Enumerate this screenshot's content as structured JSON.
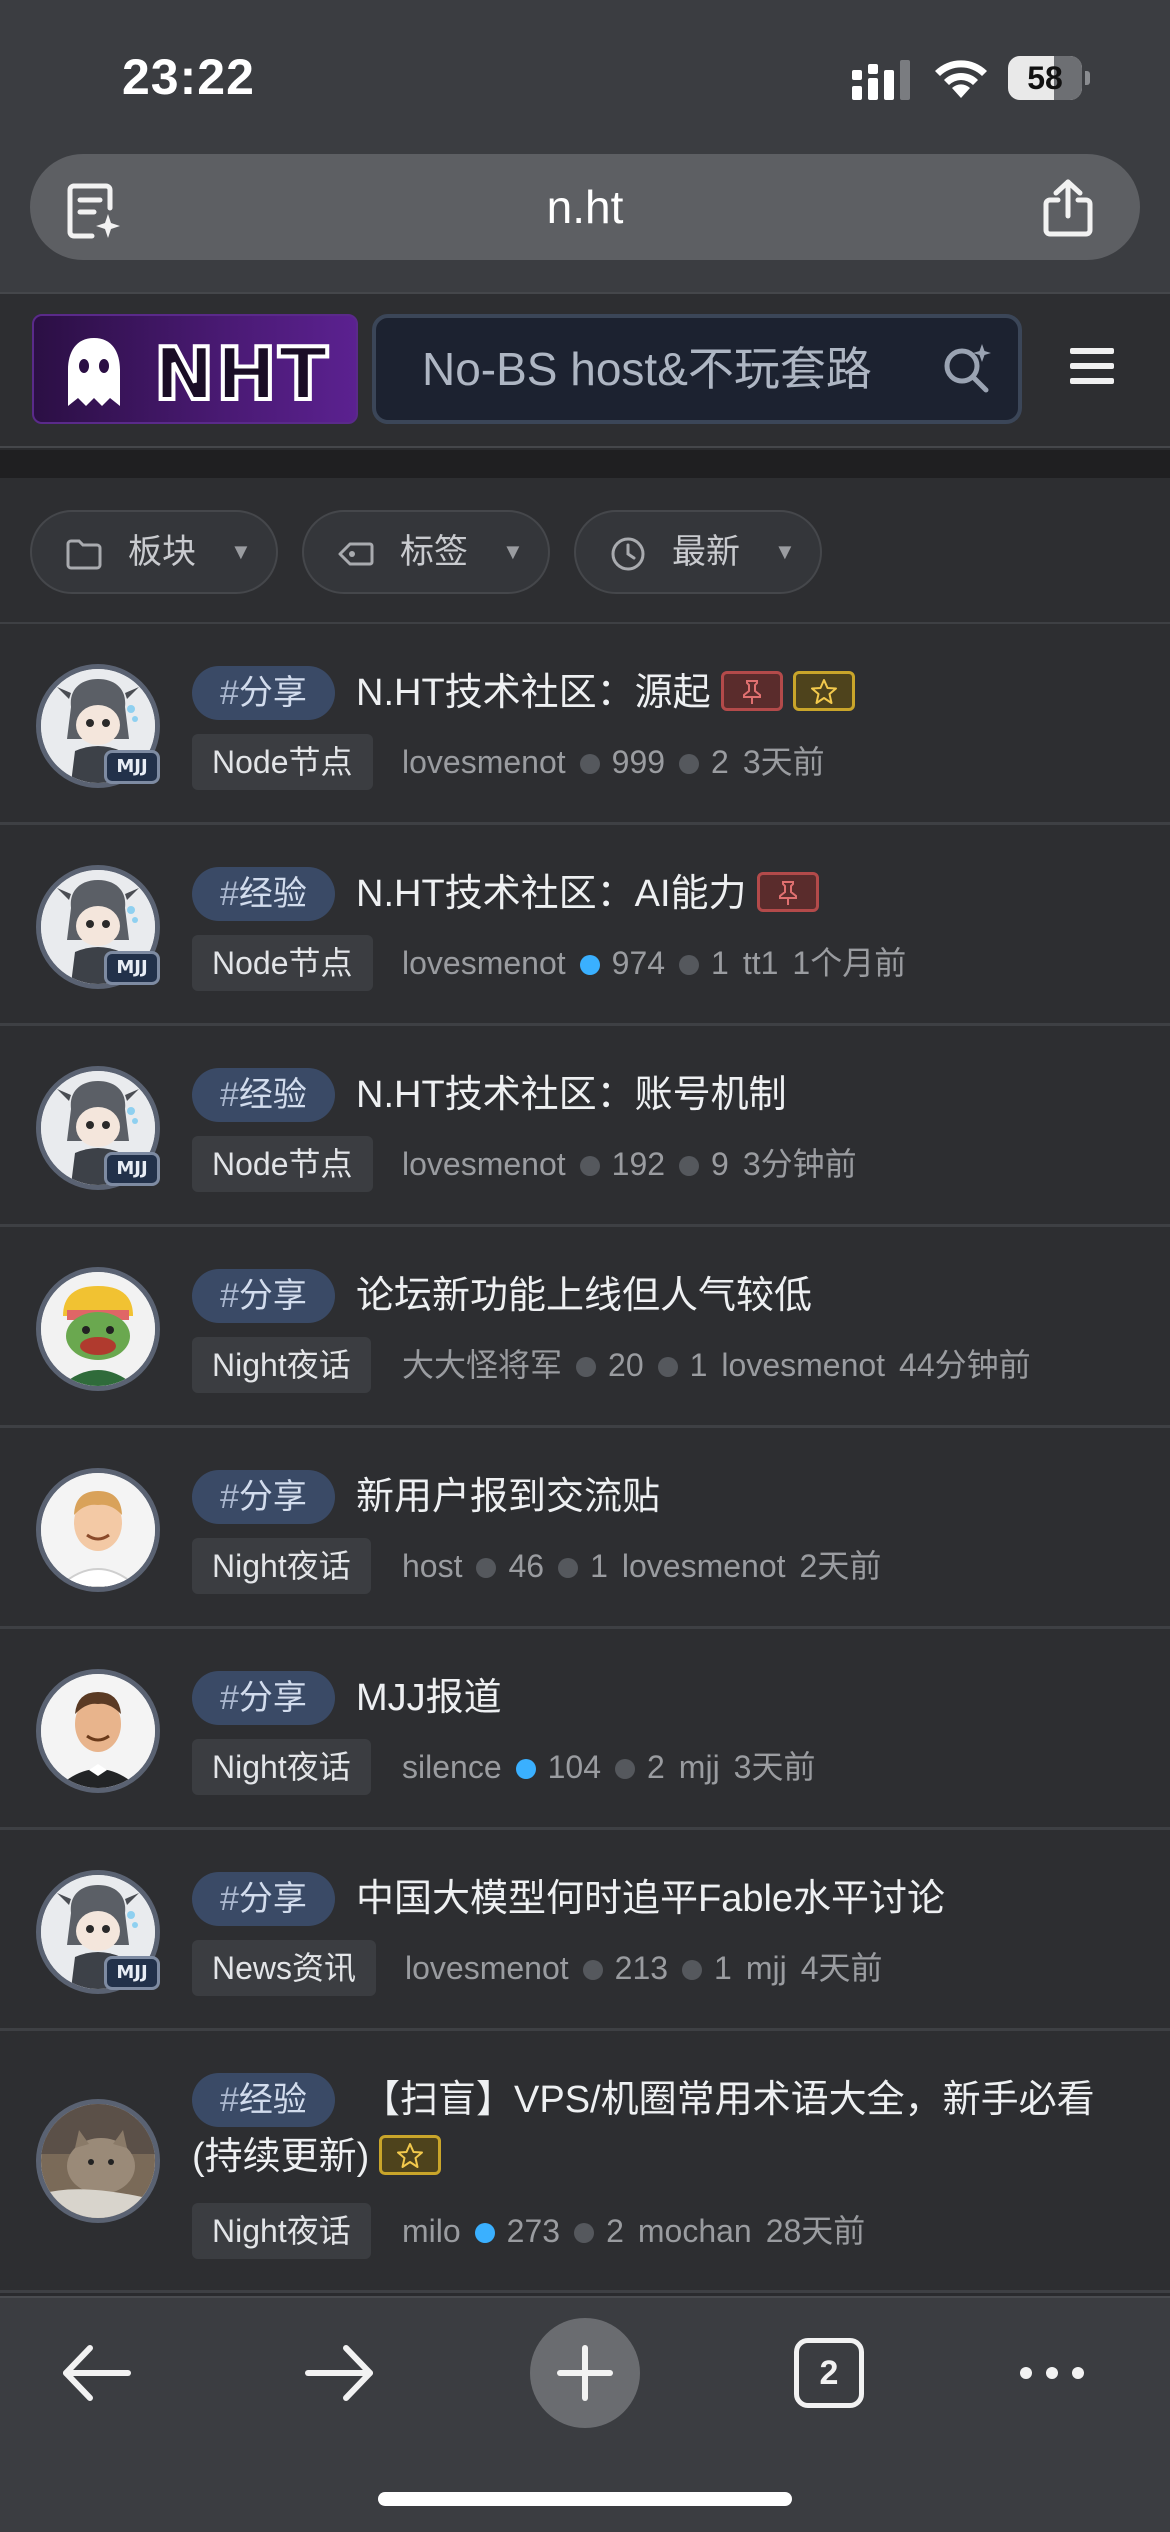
{
  "status_bar": {
    "time": "23:22",
    "battery": "58"
  },
  "browser": {
    "url": "n.ht",
    "tab_count": "2"
  },
  "site": {
    "logo_text": "NHT",
    "search_text": "No-BS host&不玩套路"
  },
  "filters": [
    {
      "label": "板块",
      "icon": "folder-icon"
    },
    {
      "label": "标签",
      "icon": "tag-icon"
    },
    {
      "label": "最新",
      "icon": "clock-icon"
    }
  ],
  "posts": [
    {
      "tag_hash": "#",
      "tag": "分享",
      "title": "N.HT技术社区：源起",
      "badges": [
        "pin",
        "star"
      ],
      "category": "Node节点",
      "author": "lovesmenot",
      "views": "999",
      "replies": "2",
      "last_user": "",
      "time": "3天前",
      "views_dot": "grey",
      "avatar": "mascot"
    },
    {
      "tag_hash": "#",
      "tag": "经验",
      "title": "N.HT技术社区：AI能力",
      "badges": [
        "pin"
      ],
      "category": "Node节点",
      "author": "lovesmenot",
      "views": "974",
      "replies": "1",
      "last_user": "tt1",
      "time": "1个月前",
      "views_dot": "blue",
      "avatar": "mascot"
    },
    {
      "tag_hash": "#",
      "tag": "经验",
      "title": "N.HT技术社区：账号机制",
      "badges": [],
      "category": "Node节点",
      "author": "lovesmenot",
      "views": "192",
      "replies": "9",
      "last_user": "",
      "time": "3分钟前",
      "views_dot": "grey",
      "avatar": "mascot"
    },
    {
      "tag_hash": "#",
      "tag": "分享",
      "title": "论坛新功能上线但人气较低",
      "badges": [],
      "category": "Night夜话",
      "author": "大大怪将军",
      "views": "20",
      "replies": "1",
      "last_user": "lovesmenot",
      "time": "44分钟前",
      "views_dot": "grey",
      "avatar": "general"
    },
    {
      "tag_hash": "#",
      "tag": "分享",
      "title": "新用户报到交流贴",
      "badges": [],
      "category": "Night夜话",
      "author": "host",
      "views": "46",
      "replies": "1",
      "last_user": "lovesmenot",
      "time": "2天前",
      "views_dot": "grey",
      "avatar": "person-blond"
    },
    {
      "tag_hash": "#",
      "tag": "分享",
      "title": "MJJ报道",
      "badges": [],
      "category": "Night夜话",
      "author": "silence",
      "views": "104",
      "replies": "2",
      "last_user": "mjj",
      "time": "3天前",
      "views_dot": "blue",
      "avatar": "person-dark"
    },
    {
      "tag_hash": "#",
      "tag": "分享",
      "title": "中国大模型何时追平Fable水平讨论",
      "badges": [],
      "category": "News资讯",
      "author": "lovesmenot",
      "views": "213",
      "replies": "1",
      "last_user": "mjj",
      "time": "4天前",
      "views_dot": "grey",
      "avatar": "mascot"
    },
    {
      "tag_hash": "#",
      "tag": "经验",
      "title": "【扫盲】VPS/机圈常用术语大全，新手必看",
      "title_line2": "(持续更新)",
      "badges": [
        "star"
      ],
      "category": "Night夜话",
      "author": "milo",
      "views": "273",
      "replies": "2",
      "last_user": "mochan",
      "time": "28天前",
      "views_dot": "blue",
      "avatar": "cat-photo"
    }
  ],
  "avatar_badge": "MJJ",
  "colors": {
    "accent_blue": "#3ab0ff",
    "pin_red": "#b34a4a",
    "star_gold": "#c9a52a",
    "tag_bg": "#3a4a66"
  }
}
